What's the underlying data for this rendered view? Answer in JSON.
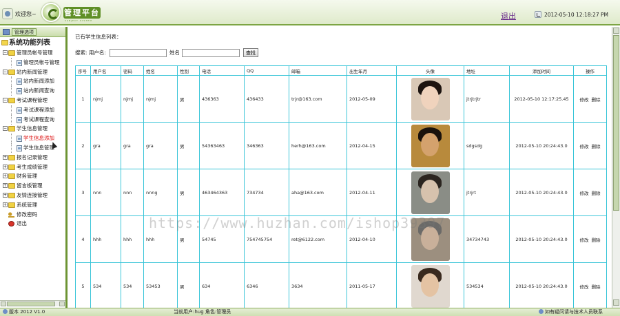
{
  "header": {
    "welcome": "欢迎您~",
    "logo_title": "管理平台",
    "logo_subtitle": "SUBJECT SYSTEM",
    "logout": "退出",
    "datetime": "2012-05-10 12:18:27 PM"
  },
  "sidebar": {
    "top_label": "管理选项",
    "root": "系统功能列表",
    "items": [
      {
        "type": "group",
        "label": "管理员帐号管理",
        "sign": "−"
      },
      {
        "type": "leaf",
        "label": "管理员帐号管理"
      },
      {
        "type": "group",
        "label": "站内新闻管理",
        "sign": "−"
      },
      {
        "type": "leaf",
        "label": "站内新闻添加"
      },
      {
        "type": "leaf",
        "label": "站内新闻查询"
      },
      {
        "type": "group",
        "label": "考试课程管理",
        "sign": "−"
      },
      {
        "type": "leaf",
        "label": "考试课程添加"
      },
      {
        "type": "leaf",
        "label": "考试课程查询"
      },
      {
        "type": "group",
        "label": "学生信息管理",
        "sign": "−"
      },
      {
        "type": "leaf",
        "label": "学生信息添加",
        "active": true
      },
      {
        "type": "leaf",
        "label": "学生信息管理"
      },
      {
        "type": "group",
        "label": "报名记录管理",
        "sign": "+"
      },
      {
        "type": "group",
        "label": "考生成绩管理",
        "sign": "+"
      },
      {
        "type": "group",
        "label": "财务管理",
        "sign": "+"
      },
      {
        "type": "group",
        "label": "留言板管理",
        "sign": "+"
      },
      {
        "type": "group",
        "label": "友情连接管理",
        "sign": "+"
      },
      {
        "type": "group",
        "label": "系统管理",
        "sign": "+"
      },
      {
        "type": "misc",
        "icon": "key-icon",
        "label": "修改密码"
      },
      {
        "type": "misc",
        "icon": "exit-icon",
        "label": "退出"
      }
    ]
  },
  "main": {
    "caption": "已有学生信息列表：",
    "search": {
      "label": "搜索: 用户名:",
      "name_label": "姓名",
      "button": "查找",
      "username_value": "",
      "name_value": ""
    },
    "table": {
      "headers": [
        "序号",
        "用户名",
        "密码",
        "姓名",
        "性别",
        "电话",
        "QQ",
        "邮箱",
        "出生年月",
        "头像",
        "地址",
        "添加时间",
        "操作"
      ],
      "rows": [
        {
          "no": "1",
          "username": "njmj",
          "password": "njmj",
          "name": "njmj",
          "gender": "男",
          "phone": "436363",
          "qq": "436433",
          "email": "trjr@163.com",
          "birth": "2012-05-09",
          "avatar": "female-portrait",
          "address": "jtrjtrjtr",
          "added": "2012-05-10 12:17:25.45",
          "edit": "修改",
          "delete": "删除"
        },
        {
          "no": "2",
          "username": "gra",
          "password": "gra",
          "name": "gra",
          "gender": "男",
          "phone": "54363463",
          "qq": "346363",
          "email": "herh@163.com",
          "birth": "2012-04-15",
          "avatar": "male-portrait",
          "address": "sdgsdg",
          "added": "2012-05-10 20:24:43.0",
          "edit": "修改",
          "delete": "删除"
        },
        {
          "no": "3",
          "username": "nnn",
          "password": "nnn",
          "name": "nnng",
          "gender": "男",
          "phone": "463464363",
          "qq": "734734",
          "email": "aha@163.com",
          "birth": "2012-04-11",
          "avatar": "male-portrait",
          "address": "jtrjrt",
          "added": "2012-05-10 20:24:43.0",
          "edit": "修改",
          "delete": "删除"
        },
        {
          "no": "4",
          "username": "hhh",
          "password": "hhh",
          "name": "hhh",
          "gender": "男",
          "phone": "54745",
          "qq": "754745754",
          "email": "ret@6122.com",
          "birth": "2012-04-10",
          "avatar": "male-portrait",
          "address": "34734743",
          "added": "2012-05-10 20:24:43.0",
          "edit": "修改",
          "delete": "删除"
        },
        {
          "no": "5",
          "username": "534",
          "password": "534",
          "name": "53453",
          "gender": "男",
          "phone": "634",
          "qq": "6346",
          "email": "3634",
          "birth": "2011-05-17",
          "avatar": "male-portrait",
          "address": "534534",
          "added": "2012-05-10 20:24:43.0",
          "edit": "修改",
          "delete": "删除"
        }
      ]
    }
  },
  "footer": {
    "version": "版本 2012 V1.0",
    "current_user": "当前用户:hug  角色:管理员",
    "contact": "如有疑问请与技术人员联系"
  },
  "watermark": "https://www.huzhan.com/ishop39397",
  "colors": {
    "accent_green": "#6d9433",
    "table_border": "#39c5d8",
    "active_item": "#dd1111",
    "logout_link": "#6a2c8a"
  }
}
